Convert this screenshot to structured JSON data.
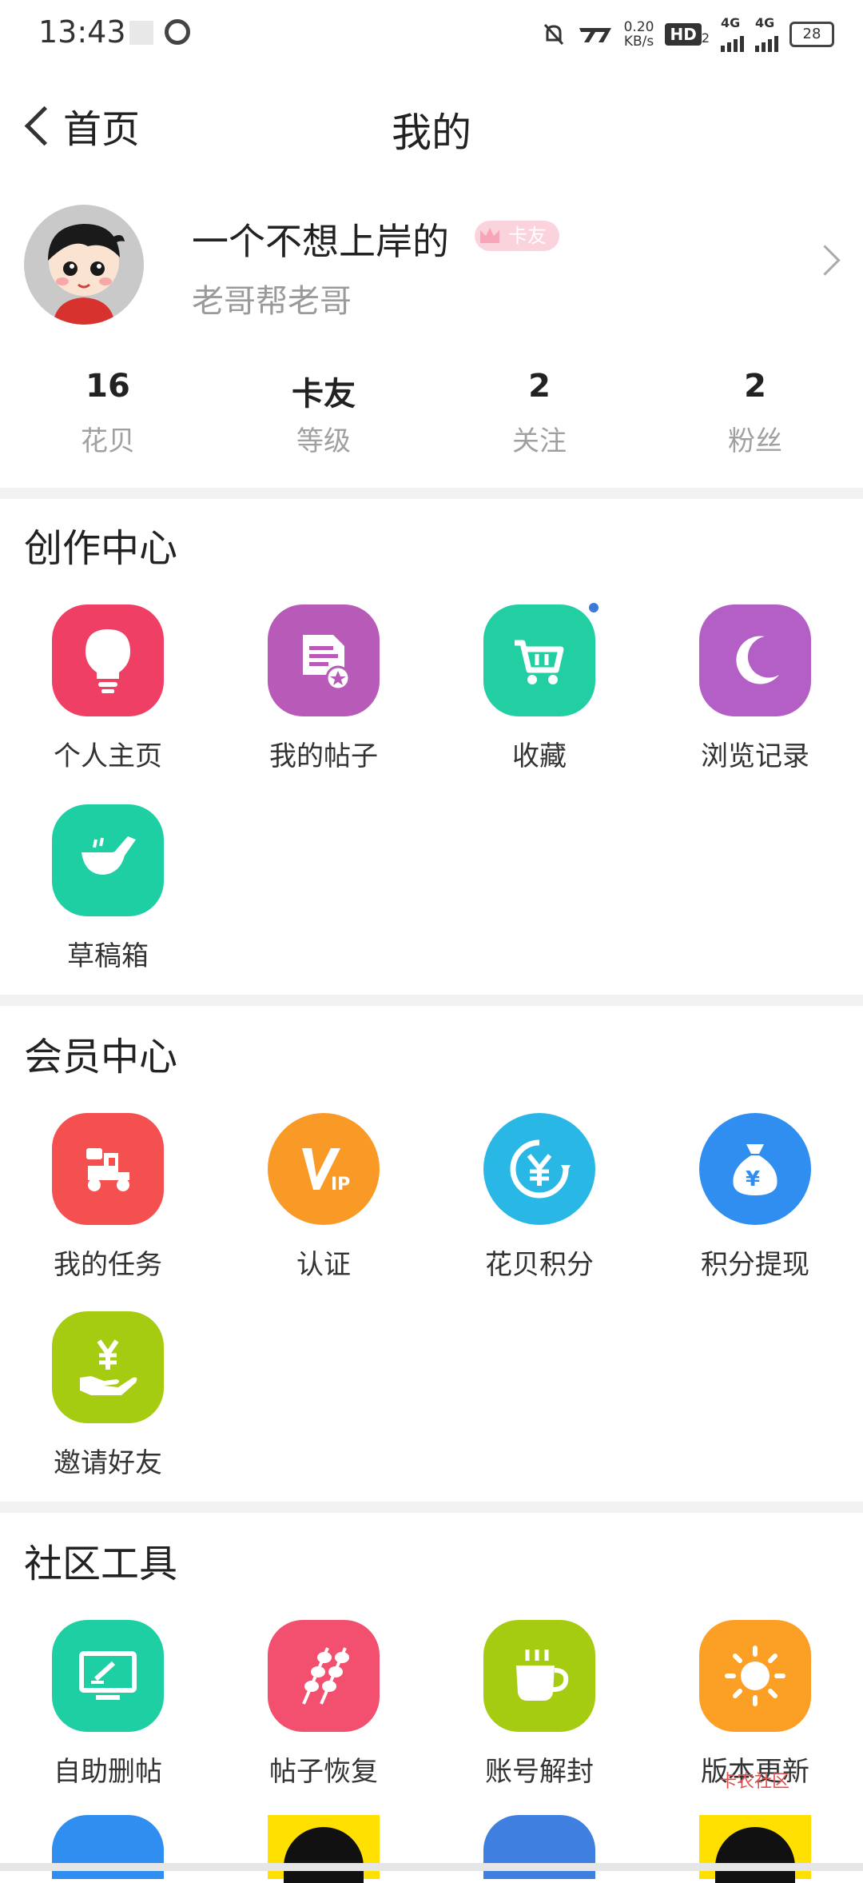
{
  "status_bar": {
    "time": "13:43",
    "speed": "0.20",
    "speed_unit": "KB/s",
    "hd_label": "HD",
    "hd_sub": "2",
    "net1": "4G",
    "net2": "4G",
    "battery": "28",
    "icons": [
      "notification-off-icon",
      "nfc-icon",
      "hd-icon",
      "signal-icon",
      "signal-icon",
      "battery-icon"
    ]
  },
  "nav": {
    "back_label": "首页",
    "title": "我的"
  },
  "profile": {
    "name": "一个不想上岸的",
    "badge": "卡友",
    "subtitle": "老哥帮老哥"
  },
  "stats": [
    {
      "value": "16",
      "label": "花贝"
    },
    {
      "value": "卡友",
      "label": "等级"
    },
    {
      "value": "2",
      "label": "关注"
    },
    {
      "value": "2",
      "label": "粉丝"
    }
  ],
  "sections": {
    "creation": {
      "title": "创作中心",
      "items": [
        {
          "label": "个人主页",
          "icon": "lightbulb-icon",
          "color": "#f03f64"
        },
        {
          "label": "我的帖子",
          "icon": "document-icon",
          "color": "#b85ab8"
        },
        {
          "label": "收藏",
          "icon": "cart-icon",
          "color": "#22cfa3"
        },
        {
          "label": "浏览记录",
          "icon": "moon-icon",
          "color": "#b45fc6"
        },
        {
          "label": "草稿箱",
          "icon": "pipe-icon",
          "color": "#1fcfa4"
        }
      ]
    },
    "member": {
      "title": "会员中心",
      "items": [
        {
          "label": "我的任务",
          "icon": "scooter-icon",
          "color": "#f45050"
        },
        {
          "label": "认证",
          "icon": "vip-icon",
          "color": "#f99a26"
        },
        {
          "label": "花贝积分",
          "icon": "yen-cycle-icon",
          "color": "#29b8e6"
        },
        {
          "label": "积分提现",
          "icon": "money-bag-icon",
          "color": "#2f8ef0"
        },
        {
          "label": "邀请好友",
          "icon": "hand-yen-icon",
          "color": "#a6cc12"
        }
      ]
    },
    "tools": {
      "title": "社区工具",
      "items": [
        {
          "label": "自助删帖",
          "icon": "monitor-pen-icon",
          "color": "#1fcfa4"
        },
        {
          "label": "帖子恢复",
          "icon": "skewer-icon",
          "color": "#f2506e"
        },
        {
          "label": "账号解封",
          "icon": "cup-icon",
          "color": "#a6cc12"
        },
        {
          "label": "版本更新",
          "icon": "sun-icon",
          "color": "#fba024"
        }
      ]
    }
  },
  "watermark": "卡农社区"
}
